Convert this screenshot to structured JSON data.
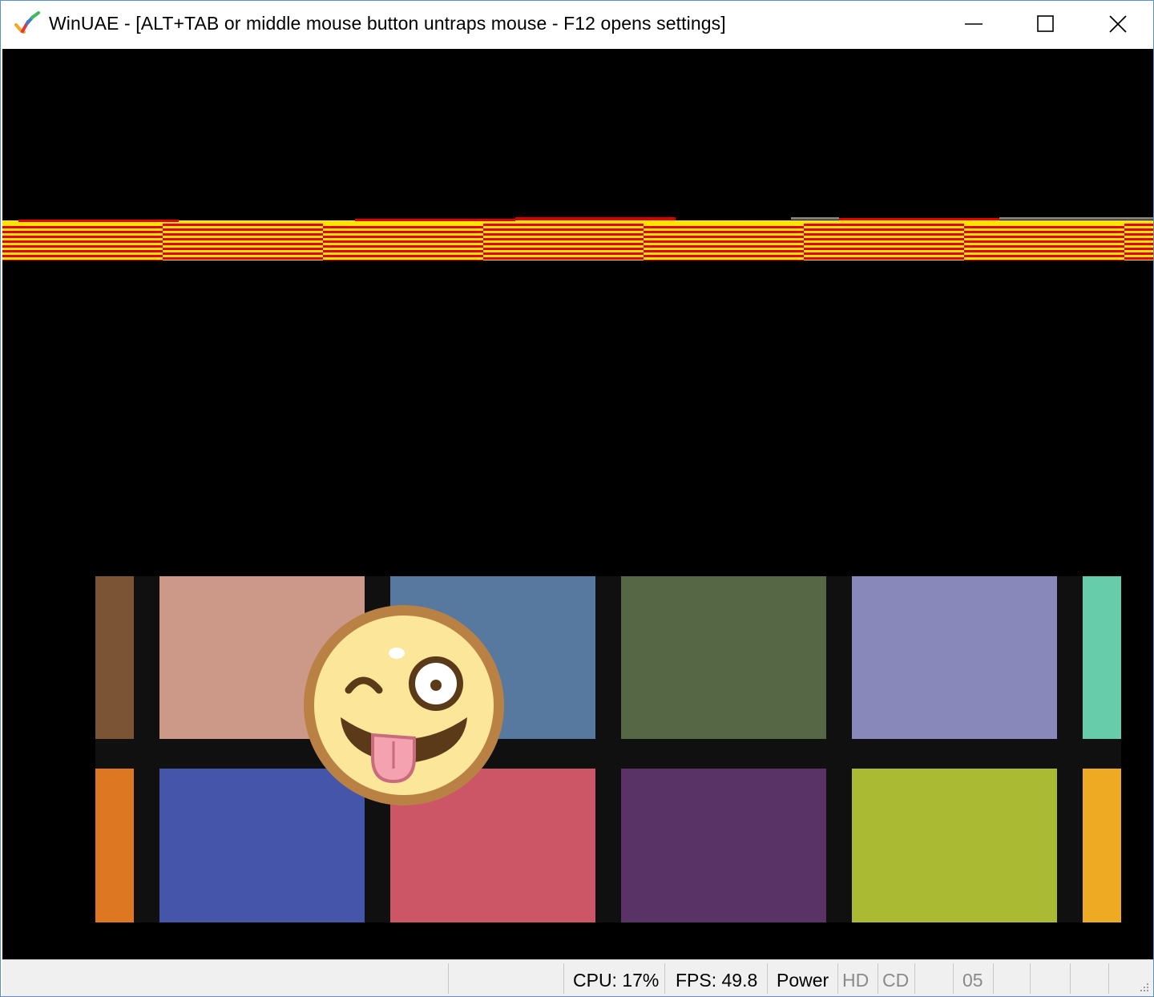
{
  "window": {
    "title": "WinUAE - [ALT+TAB or middle mouse button untraps mouse - F12 opens settings]",
    "controls": {
      "minimize": "minimize-icon",
      "maximize": "maximize-icon",
      "close": "close-icon"
    }
  },
  "screen": {
    "background": "#000000",
    "copper_colors": [
      "#ffe400",
      "#e40000"
    ],
    "tiles_top": [
      {
        "color": "#7a5434"
      },
      {
        "color": "#cc9888"
      },
      {
        "color": "#5779a0"
      },
      {
        "color": "#556744"
      },
      {
        "color": "#8888bb"
      },
      {
        "color": "#66ccaa"
      }
    ],
    "tiles_bottom": [
      {
        "color": "#dd7722"
      },
      {
        "color": "#4455aa"
      },
      {
        "color": "#cc5566"
      },
      {
        "color": "#593366"
      },
      {
        "color": "#aabb33"
      },
      {
        "color": "#eeaa22"
      }
    ],
    "sprite": "winking-tongue-smiley-icon"
  },
  "statusbar": {
    "cpu": "CPU: 17%",
    "fps": "FPS: 49.8",
    "power": "Power",
    "hd": "HD",
    "cd": "CD",
    "drive": "05"
  }
}
